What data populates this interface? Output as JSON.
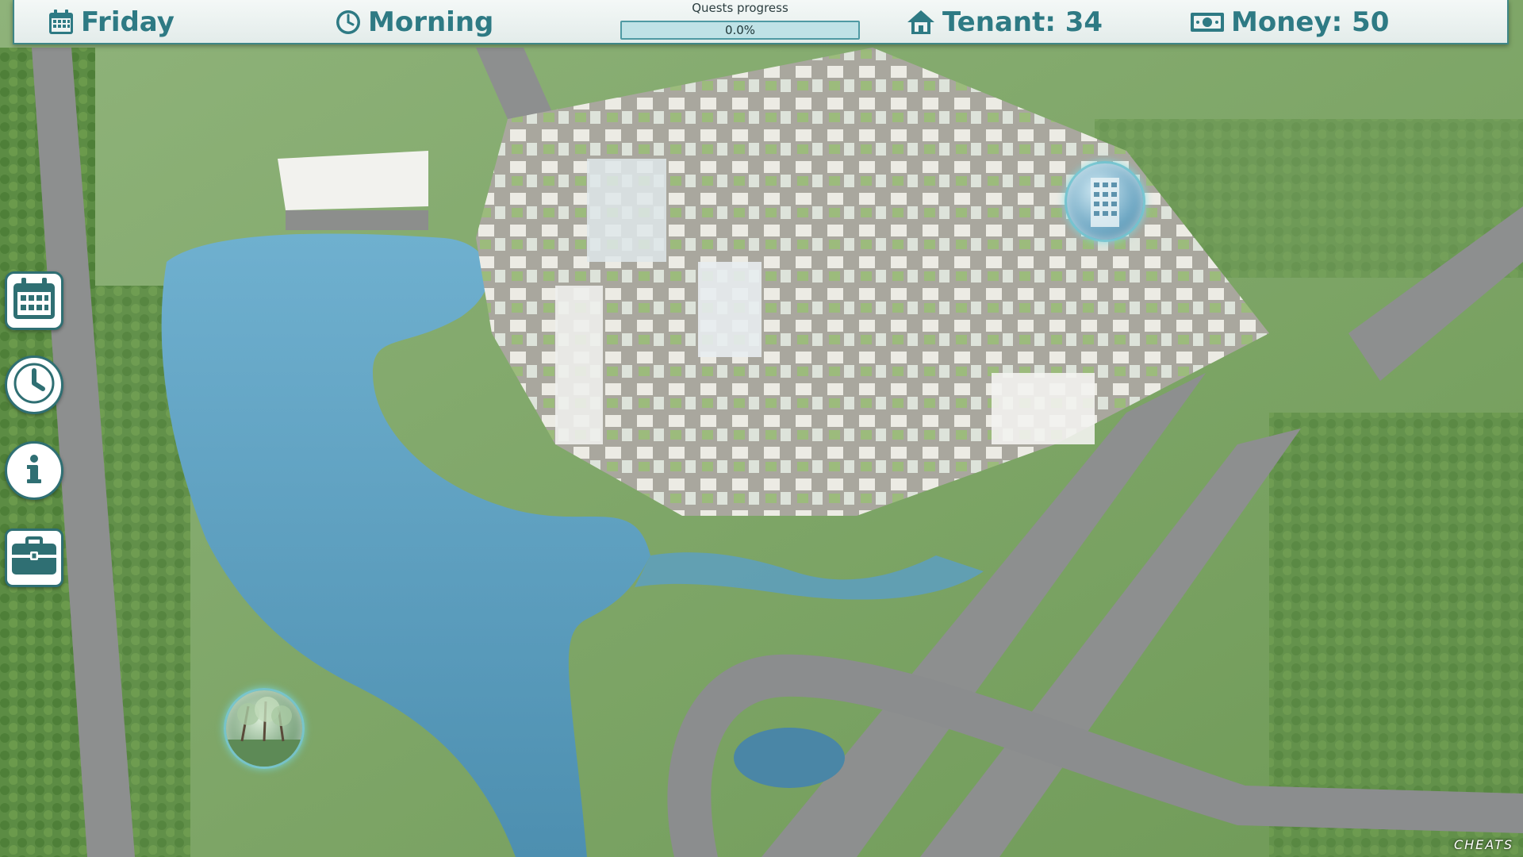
{
  "hud": {
    "day": "Friday",
    "time_of_day": "Morning",
    "quests": {
      "label": "Quests progress",
      "value_text": "0.0%",
      "progress": 0.0
    },
    "tenant_text": "Tenant: 34",
    "money_text": "Money: 50"
  },
  "icons": {
    "day": "calendar-icon",
    "time": "clock-icon",
    "tenant": "house-icon",
    "money": "banknote-icon"
  },
  "side_menu": [
    {
      "name": "calendar-button",
      "icon": "calendar-icon"
    },
    {
      "name": "clock-button",
      "icon": "clock-icon"
    },
    {
      "name": "info-button",
      "icon": "info-icon"
    },
    {
      "name": "jobs-button",
      "icon": "briefcase-icon"
    }
  ],
  "map": {
    "scene": "aerial city district with lake, parks and highway interchange",
    "locations": [
      "building-location-orb",
      "park-location-orb"
    ]
  },
  "cheats_label": "CHEATS",
  "colors": {
    "accent": "#2e7a84",
    "hud_border": "#3f8686",
    "hud_bg": "#eef4f3",
    "button_border": "#2f6f73",
    "water": "#5d9fc0",
    "grass": "#7fa866"
  }
}
